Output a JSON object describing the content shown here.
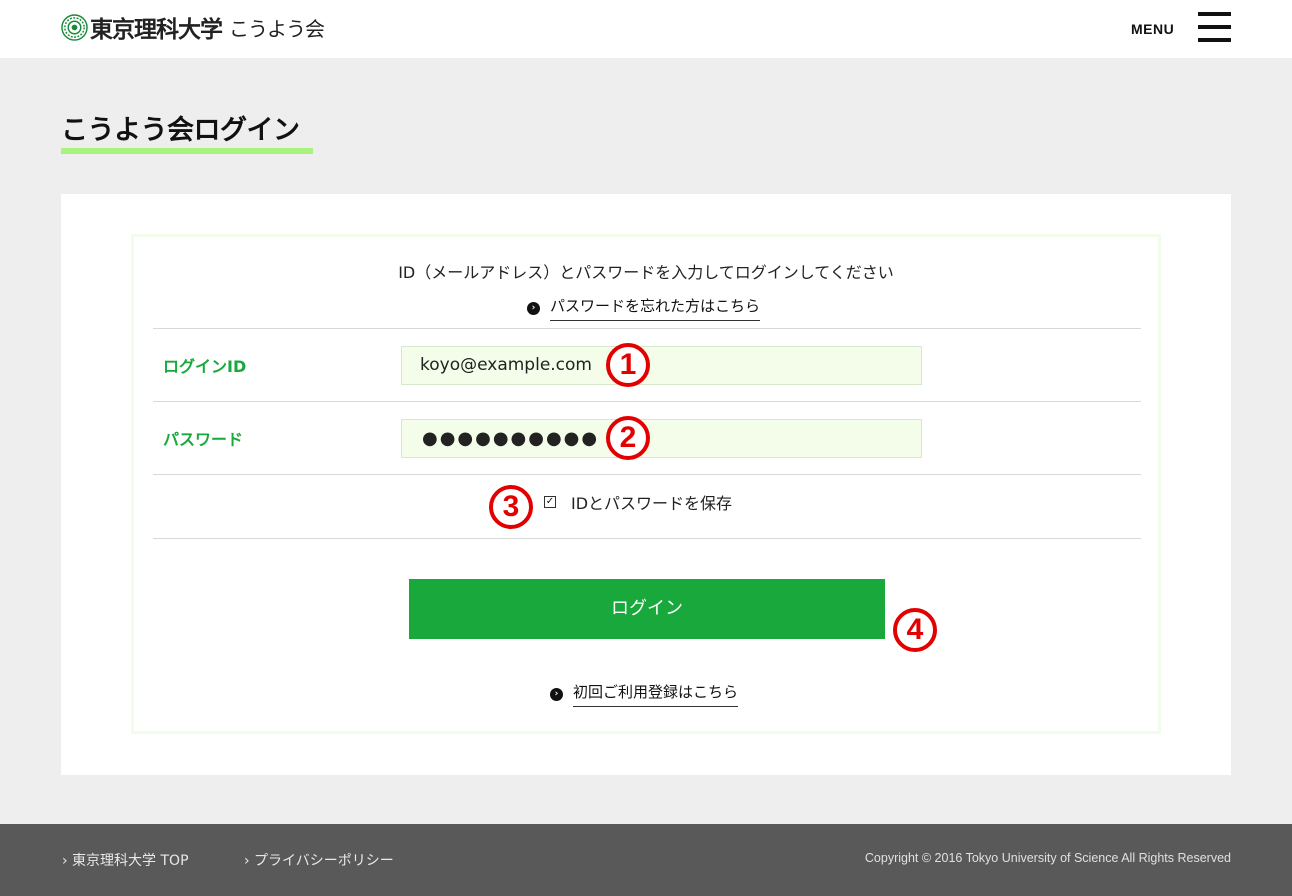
{
  "header": {
    "logo_univ": "東京理科大学",
    "logo_assoc": "こうよう会",
    "menu_label": "MENU",
    "menu_icon": "hamburger-icon"
  },
  "page": {
    "title": "こうよう会ログイン"
  },
  "login_form": {
    "intro": "ID（メールアドレス）とパスワードを入力してログインしてください",
    "forgot_link": "パスワードを忘れた方はこちら",
    "login_id_label": "ログインID",
    "login_id_value": "koyo@example.com",
    "password_label": "パスワード",
    "password_value": "●●●●●●●●●●",
    "save_checked": true,
    "save_label": "IDとパスワードを保存",
    "login_button": "ログイン",
    "register_link": "初回ご利用登録はこちら",
    "link_icon": "circle-arrow-icon"
  },
  "annotations": {
    "marker_1": "1",
    "marker_2": "2",
    "marker_3": "3",
    "marker_4": "4",
    "color": "#e20000"
  },
  "footer": {
    "link_top": "› 東京理科大学 TOP",
    "link_privacy": "› プライバシーポリシー",
    "copyright": "Copyright © 2016 Tokyo University of Science All Rights Reserved"
  },
  "colors": {
    "accent_green": "#18a83c",
    "underline_green": "#a9f27e",
    "input_bg": "#f3fde9",
    "footer_bg": "#595959"
  }
}
